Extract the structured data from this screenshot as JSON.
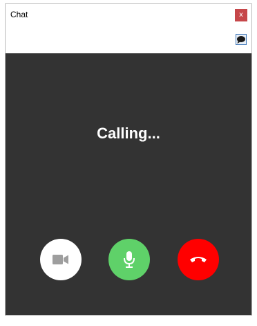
{
  "window": {
    "title": "Chat",
    "close_label": "x"
  },
  "call": {
    "status": "Calling..."
  },
  "controls": {
    "video_icon": "video-camera-icon",
    "mic_icon": "microphone-icon",
    "hangup_icon": "phone-hangup-icon"
  },
  "colors": {
    "close_button": "#c6474a",
    "call_background": "#333333",
    "video_button": "#ffffff",
    "mic_button": "#5fd169",
    "hangup_button": "#ff0000"
  }
}
